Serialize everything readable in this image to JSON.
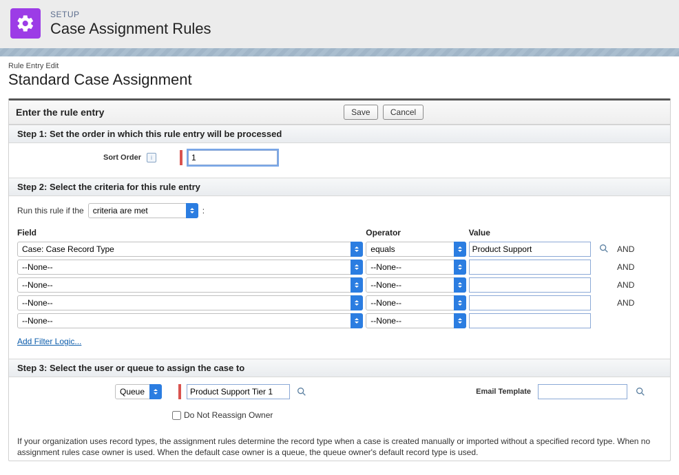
{
  "header": {
    "breadcrumb": "SETUP",
    "title": "Case Assignment Rules"
  },
  "page": {
    "subtitle_small": "Rule Entry Edit",
    "subtitle": "Standard Case Assignment"
  },
  "panel": {
    "entry_title": "Enter the rule entry",
    "save": "Save",
    "cancel": "Cancel"
  },
  "step1": {
    "title": "Step 1: Set the order in which this rule entry will be processed",
    "label": "Sort Order",
    "value": "1"
  },
  "step2": {
    "title": "Step 2: Select the criteria for this rule entry",
    "run_label": "Run this rule if the",
    "run_colon": ":",
    "condition_select": "criteria are met",
    "headers": {
      "field": "Field",
      "operator": "Operator",
      "value": "Value"
    },
    "and": "AND",
    "rows": [
      {
        "field": "Case: Case Record Type",
        "op": "equals",
        "val": "Product Support",
        "lookup": true,
        "and": true
      },
      {
        "field": "--None--",
        "op": "--None--",
        "val": "",
        "lookup": false,
        "and": true
      },
      {
        "field": "--None--",
        "op": "--None--",
        "val": "",
        "lookup": false,
        "and": true
      },
      {
        "field": "--None--",
        "op": "--None--",
        "val": "",
        "lookup": false,
        "and": true
      },
      {
        "field": "--None--",
        "op": "--None--",
        "val": "",
        "lookup": false,
        "and": false
      }
    ],
    "add_filter": "Add Filter Logic..."
  },
  "step3": {
    "title": "Step 3: Select the user or queue to assign the case to",
    "assign_type": "Queue",
    "assignee": "Product Support Tier 1",
    "email_label": "Email Template",
    "email_value": "",
    "reassign_label": "Do Not Reassign Owner"
  },
  "footnote": "If your organization uses record types, the assignment rules determine the record type when a case is created manually or imported without a specified record type. When no assignment rules case owner is used. When the default case owner is a queue, the queue owner's default record type is used."
}
